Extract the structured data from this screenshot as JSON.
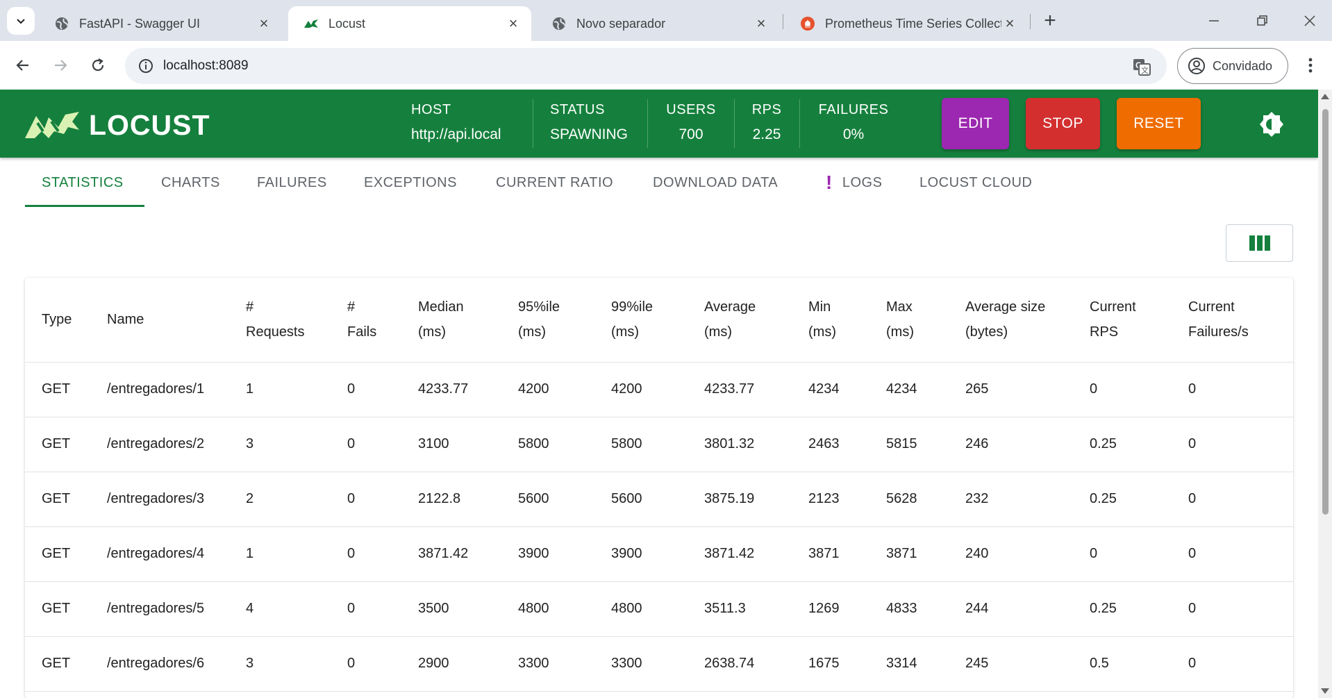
{
  "browser": {
    "tabs": [
      {
        "title": "FastAPI - Swagger UI",
        "icon": "globe-icon"
      },
      {
        "title": "Locust",
        "icon": "locust-icon"
      },
      {
        "title": "Novo separador",
        "icon": "globe-icon"
      },
      {
        "title": "Prometheus Time Series Collect",
        "icon": "prometheus-icon"
      }
    ],
    "url": "localhost:8089",
    "profile": "Convidado"
  },
  "header": {
    "logo_text": "LOCUST",
    "host_label": "HOST",
    "host_value": "http://api.local",
    "status_label": "STATUS",
    "status_value": "SPAWNING",
    "users_label": "USERS",
    "users_value": "700",
    "rps_label": "RPS",
    "rps_value": "2.25",
    "failures_label": "FAILURES",
    "failures_value": "0%",
    "edit": "EDIT",
    "stop": "STOP",
    "reset": "RESET",
    "colors": {
      "header": "#15803d",
      "edit": "#9c27b0",
      "stop": "#d32f2f",
      "reset": "#ef6c00"
    }
  },
  "tabs": [
    "STATISTICS",
    "CHARTS",
    "FAILURES",
    "EXCEPTIONS",
    "CURRENT RATIO",
    "DOWNLOAD DATA",
    "LOGS",
    "LOCUST CLOUD"
  ],
  "table": {
    "headers": [
      [
        "Type"
      ],
      [
        "Name"
      ],
      [
        "#",
        "Requests"
      ],
      [
        "#",
        "Fails"
      ],
      [
        "Median",
        "(ms)"
      ],
      [
        "95%ile",
        "(ms)"
      ],
      [
        "99%ile",
        "(ms)"
      ],
      [
        "Average",
        "(ms)"
      ],
      [
        "Min",
        "(ms)"
      ],
      [
        "Max",
        "(ms)"
      ],
      [
        "Average size",
        "(bytes)"
      ],
      [
        "Current",
        "RPS"
      ],
      [
        "Current",
        "Failures/s"
      ]
    ],
    "rows": [
      [
        "GET",
        "/entregadores/1",
        "1",
        "0",
        "4233.77",
        "4200",
        "4200",
        "4233.77",
        "4234",
        "4234",
        "265",
        "0",
        "0"
      ],
      [
        "GET",
        "/entregadores/2",
        "3",
        "0",
        "3100",
        "5800",
        "5800",
        "3801.32",
        "2463",
        "5815",
        "246",
        "0.25",
        "0"
      ],
      [
        "GET",
        "/entregadores/3",
        "2",
        "0",
        "2122.8",
        "5600",
        "5600",
        "3875.19",
        "2123",
        "5628",
        "232",
        "0.25",
        "0"
      ],
      [
        "GET",
        "/entregadores/4",
        "1",
        "0",
        "3871.42",
        "3900",
        "3900",
        "3871.42",
        "3871",
        "3871",
        "240",
        "0",
        "0"
      ],
      [
        "GET",
        "/entregadores/5",
        "4",
        "0",
        "3500",
        "4800",
        "4800",
        "3511.3",
        "1269",
        "4833",
        "244",
        "0.25",
        "0"
      ],
      [
        "GET",
        "/entregadores/6",
        "3",
        "0",
        "2900",
        "3300",
        "3300",
        "2638.74",
        "1675",
        "3314",
        "245",
        "0.5",
        "0"
      ]
    ]
  }
}
